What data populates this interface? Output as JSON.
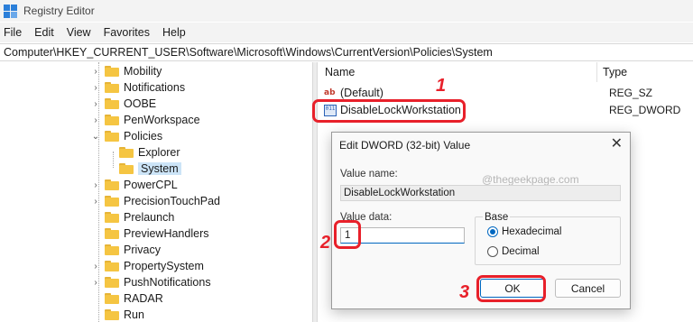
{
  "window": {
    "title": "Registry Editor"
  },
  "menu": [
    "File",
    "Edit",
    "View",
    "Favorites",
    "Help"
  ],
  "address": "Computer\\HKEY_CURRENT_USER\\Software\\Microsoft\\Windows\\CurrentVersion\\Policies\\System",
  "tree": {
    "items": [
      {
        "label": "Mobility",
        "chevron": "›"
      },
      {
        "label": "Notifications",
        "chevron": "›"
      },
      {
        "label": "OOBE",
        "chevron": "›"
      },
      {
        "label": "PenWorkspace",
        "chevron": "›"
      },
      {
        "label": "Policies",
        "chevron": "⌄"
      },
      {
        "label": "Explorer",
        "chevron": ""
      },
      {
        "label": "System",
        "chevron": ""
      },
      {
        "label": "PowerCPL",
        "chevron": "›"
      },
      {
        "label": "PrecisionTouchPad",
        "chevron": "›"
      },
      {
        "label": "Prelaunch",
        "chevron": ""
      },
      {
        "label": "PreviewHandlers",
        "chevron": ""
      },
      {
        "label": "Privacy",
        "chevron": ""
      },
      {
        "label": "PropertySystem",
        "chevron": "›"
      },
      {
        "label": "PushNotifications",
        "chevron": "›"
      },
      {
        "label": "RADAR",
        "chevron": ""
      },
      {
        "label": "Run",
        "chevron": ""
      }
    ]
  },
  "values_pane": {
    "headers": {
      "name": "Name",
      "type": "Type"
    },
    "rows": [
      {
        "icon": "ab",
        "name": "(Default)",
        "type": "REG_SZ"
      },
      {
        "icon": "011",
        "name": "DisableLockWorkstation",
        "type": "REG_DWORD"
      }
    ]
  },
  "dialog": {
    "title": "Edit DWORD (32-bit) Value",
    "close": "✕",
    "value_name_label": "Value name:",
    "value_name": "DisableLockWorkstation",
    "value_data_label": "Value data:",
    "value_data": "1",
    "base_label": "Base",
    "hex_label": "Hexadecimal",
    "dec_label": "Decimal",
    "ok": "OK",
    "cancel": "Cancel",
    "watermark": "@thegeekpage.com"
  },
  "annotations": {
    "step1": "1",
    "step2": "2",
    "step3": "3"
  },
  "colors": {
    "highlight": "#e8202a",
    "accent": "#0067c0",
    "selection": "#cce4f7"
  }
}
